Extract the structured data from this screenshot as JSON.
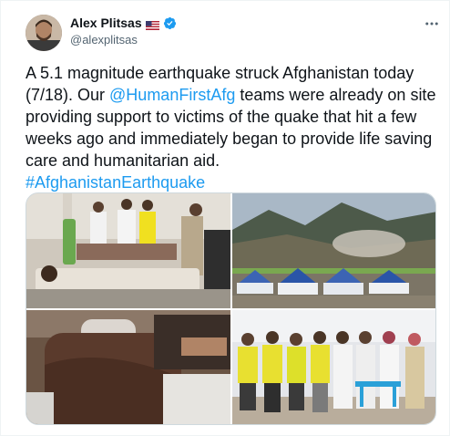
{
  "author": {
    "name": "Alex Plitsas",
    "handle": "@alexplitsas",
    "flag_icon": "us-flag-icon",
    "verified_icon": "verified-badge-icon",
    "verified_color": "#1d9bf0"
  },
  "tweet": {
    "text_parts": {
      "p1": "A 5.1 magnitude earthquake struck Afghanistan today (7/18). Our ",
      "mention": "@HumanFirstAfg",
      "p2": " teams were already on site providing support to victims of the quake that hit a few weeks ago and immediately began to provide life saving care and humanitarian aid.",
      "hashtag": "#AfghanistanEarthquake"
    },
    "link_color": "#1d9bf0"
  },
  "media": {
    "photos": [
      {
        "name": "hospital-ward-photo"
      },
      {
        "name": "tent-camp-mountains-photo"
      },
      {
        "name": "injured-patient-photo"
      },
      {
        "name": "aid-team-group-photo"
      }
    ]
  },
  "menu": {
    "more_icon": "more-horizontal-icon"
  }
}
